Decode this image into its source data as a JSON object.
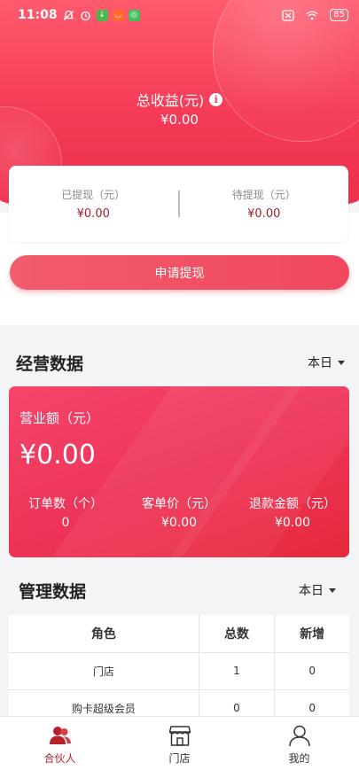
{
  "status_bar": {
    "time": "11:08",
    "battery": "85",
    "app_icon_colors": [
      "#49b84e",
      "#ff6a2a",
      "#3ec25a"
    ]
  },
  "summary": {
    "title": "总收益(元)",
    "value": "¥0.00",
    "info_icon": "info-icon"
  },
  "withdraw": {
    "withdrawn_label": "已提现（元）",
    "withdrawn_value": "¥0.00",
    "pending_label": "待提现（元）",
    "pending_value": "¥0.00",
    "apply_button": "申请提现"
  },
  "business": {
    "title": "经营数据",
    "period": "本日",
    "revenue_label": "营业额（元）",
    "revenue_value": "¥0.00",
    "stats": [
      {
        "label": "订单数（个）",
        "value": "0"
      },
      {
        "label": "客单价（元）",
        "value": "¥0.00"
      },
      {
        "label": "退款金额（元）",
        "value": "¥0.00"
      }
    ]
  },
  "management": {
    "title": "管理数据",
    "period": "本日",
    "columns": [
      "角色",
      "总数",
      "新增"
    ],
    "rows": [
      [
        "门店",
        "1",
        "0"
      ],
      [
        "购卡超级会员",
        "0",
        "0"
      ]
    ]
  },
  "nav": {
    "items": [
      {
        "label": "合伙人",
        "icon": "partner-icon",
        "active": true
      },
      {
        "label": "门店",
        "icon": "store-icon",
        "active": false
      },
      {
        "label": "我的",
        "icon": "user-icon",
        "active": false
      }
    ]
  },
  "colors": {
    "accent": "#f0425a",
    "dark_red": "#a41e29",
    "nav_active": "#b8202d"
  }
}
